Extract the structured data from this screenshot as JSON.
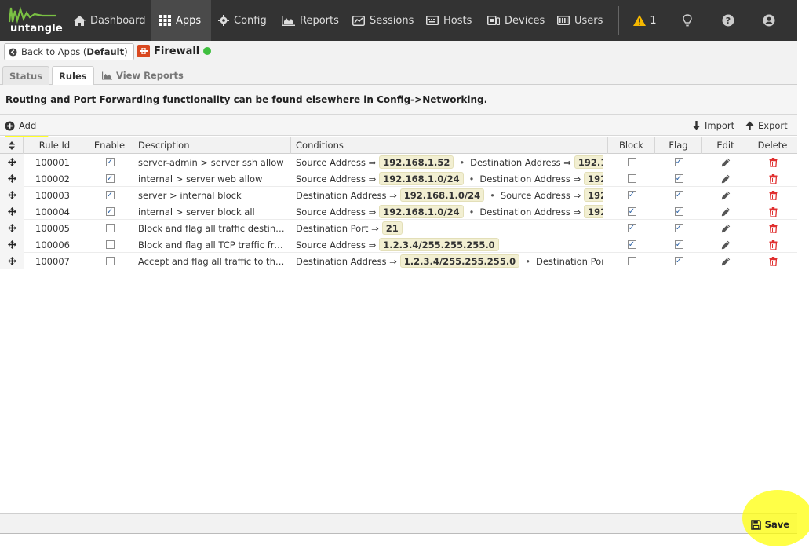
{
  "nav": {
    "logo_text": "untangle",
    "items": [
      {
        "label": "Dashboard",
        "icon": "home-icon"
      },
      {
        "label": "Apps",
        "icon": "grid-icon"
      },
      {
        "label": "Config",
        "icon": "gear-icon"
      },
      {
        "label": "Reports",
        "icon": "area-chart-icon"
      },
      {
        "label": "Sessions",
        "icon": "sessions-icon"
      },
      {
        "label": "Hosts",
        "icon": "hosts-icon"
      },
      {
        "label": "Devices",
        "icon": "devices-icon"
      },
      {
        "label": "Users",
        "icon": "users-icon"
      }
    ],
    "active_item": "Apps",
    "alert_count": "1"
  },
  "header": {
    "back_label_prefix": "Back to Apps (",
    "back_label_policy": "Default",
    "back_label_suffix": ")",
    "app_name": "Firewall",
    "status_color": "#3fbf3f"
  },
  "tabs": [
    {
      "label": "Status"
    },
    {
      "label": "Rules"
    },
    {
      "label": "View Reports"
    }
  ],
  "notice": "Routing and Port Forwarding functionality can be found elsewhere in Config->Networking.",
  "toolbar": {
    "add_label": "Add",
    "import_label": "Import",
    "export_label": "Export"
  },
  "grid": {
    "columns": [
      "Rule Id",
      "Enable",
      "Description",
      "Conditions",
      "Block",
      "Flag",
      "Edit",
      "Delete"
    ],
    "rows": [
      {
        "id": "100001",
        "enable": true,
        "description": "server-admin > server ssh allow",
        "conditions": [
          {
            "label": "Source Address ⇒",
            "value": "192.168.1.52"
          },
          {
            "label": "Destination Address ⇒",
            "value": "192.1…"
          }
        ],
        "block": false,
        "flag": true
      },
      {
        "id": "100002",
        "enable": true,
        "description": "internal > server web allow",
        "conditions": [
          {
            "label": "Source Address ⇒",
            "value": "192.168.1.0/24"
          },
          {
            "label": "Destination Address ⇒",
            "value": "192…"
          }
        ],
        "block": false,
        "flag": true
      },
      {
        "id": "100003",
        "enable": true,
        "description": "server > internal block",
        "conditions": [
          {
            "label": "Destination Address ⇒",
            "value": "192.168.1.0/24"
          },
          {
            "label": "Source Address ⇒",
            "value": "192…"
          }
        ],
        "block": true,
        "flag": true
      },
      {
        "id": "100004",
        "enable": true,
        "description": "internal > server block all",
        "conditions": [
          {
            "label": "Source Address ⇒",
            "value": "192.168.1.0/24"
          },
          {
            "label": "Destination Address ⇒",
            "value": "192…"
          }
        ],
        "block": true,
        "flag": true
      },
      {
        "id": "100005",
        "enable": false,
        "description": "Block and flag all traffic destine…",
        "conditions": [
          {
            "label": "Destination Port ⇒",
            "value": "21"
          }
        ],
        "block": true,
        "flag": true
      },
      {
        "id": "100006",
        "enable": false,
        "description": "Block and flag all TCP traffic fro…",
        "conditions": [
          {
            "label": "Source Address ⇒",
            "value": "1.2.3.4/255.255.255.0"
          }
        ],
        "block": true,
        "flag": true
      },
      {
        "id": "100007",
        "enable": false,
        "description": "Accept and flag all traffic to the …",
        "conditions": [
          {
            "label": "Destination Address ⇒",
            "value": "1.2.3.4/255.255.255.0"
          },
          {
            "label": "Destination Port…",
            "value": ""
          }
        ],
        "block": false,
        "flag": true
      }
    ]
  },
  "footer": {
    "save_label": "Save"
  },
  "colors": {
    "nav_bg": "#333333",
    "highlight": "#ffff00",
    "delete": "#e03030",
    "condition_chip": "#f2efd2",
    "app_icon": "#d9481f"
  }
}
